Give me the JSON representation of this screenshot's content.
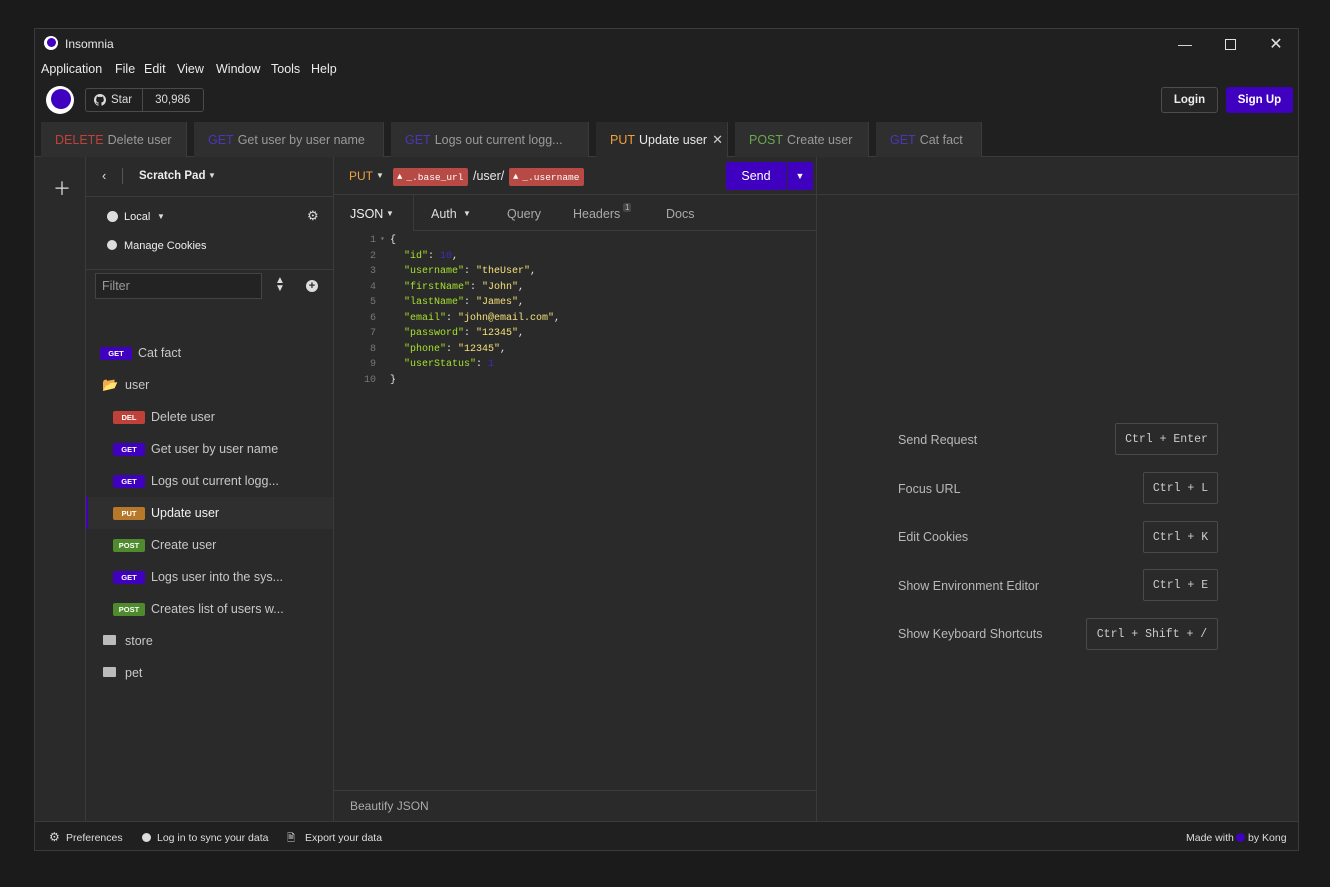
{
  "app": {
    "title": "Insomnia"
  },
  "menu": [
    "Application",
    "File",
    "Edit",
    "View",
    "Window",
    "Tools",
    "Help"
  ],
  "topbar": {
    "star_label": "Star",
    "star_count": "30,986",
    "login": "Login",
    "signup": "Sign Up"
  },
  "tabs": [
    {
      "method": "DELETE",
      "name": "Delete user",
      "color": "#c0413a"
    },
    {
      "method": "GET",
      "name": "Get user by user name",
      "color": "#4a37b8"
    },
    {
      "method": "GET",
      "name": "Logs out current logg...",
      "color": "#4a37b8"
    },
    {
      "method": "PUT",
      "name": "Update user",
      "color": "#f0a040"
    },
    {
      "method": "POST",
      "name": "Create user",
      "color": "#6aa84f"
    },
    {
      "method": "GET",
      "name": "Cat fact",
      "color": "#4a37b8"
    }
  ],
  "sidebar": {
    "workspace": "Scratch Pad",
    "environment": "Local",
    "manage_cookies": "Manage Cookies",
    "filter_placeholder": "Filter",
    "items": [
      {
        "type": "request",
        "method": "GET",
        "name": "Cat fact"
      },
      {
        "type": "folder",
        "name": "user",
        "open": true
      },
      {
        "type": "request",
        "method": "DEL",
        "name": "Delete user"
      },
      {
        "type": "request",
        "method": "GET",
        "name": "Get user by user name"
      },
      {
        "type": "request",
        "method": "GET",
        "name": "Logs out current logg..."
      },
      {
        "type": "request",
        "method": "PUT",
        "name": "Update user",
        "active": true
      },
      {
        "type": "request",
        "method": "POST",
        "name": "Create user"
      },
      {
        "type": "request",
        "method": "GET",
        "name": "Logs user into the sys..."
      },
      {
        "type": "request",
        "method": "POST",
        "name": "Creates list of users w..."
      },
      {
        "type": "folder",
        "name": "store",
        "open": false
      },
      {
        "type": "folder",
        "name": "pet",
        "open": false
      }
    ]
  },
  "request": {
    "method": "PUT",
    "url_tag_1": "_.base_url",
    "url_path": "/user/",
    "url_tag_2": "_.username",
    "send": "Send",
    "tabs": {
      "body": "JSON",
      "auth": "Auth",
      "query": "Query",
      "headers": "Headers",
      "headers_count": "1",
      "docs": "Docs"
    },
    "body_lines": [
      {
        "n": "1",
        "text": "{"
      },
      {
        "n": "2",
        "key": "\"id\"",
        "val": "10",
        "type": "num"
      },
      {
        "n": "3",
        "key": "\"username\"",
        "val": "\"theUser\"",
        "type": "str"
      },
      {
        "n": "4",
        "key": "\"firstName\"",
        "val": "\"John\"",
        "type": "str"
      },
      {
        "n": "5",
        "key": "\"lastName\"",
        "val": "\"James\"",
        "type": "str"
      },
      {
        "n": "6",
        "key": "\"email\"",
        "val": "\"john@email.com\"",
        "type": "str"
      },
      {
        "n": "7",
        "key": "\"password\"",
        "val": "\"12345\"",
        "type": "str"
      },
      {
        "n": "8",
        "key": "\"phone\"",
        "val": "\"12345\"",
        "type": "str"
      },
      {
        "n": "9",
        "key": "\"userStatus\"",
        "val": "1",
        "type": "num",
        "last": true
      },
      {
        "n": "10",
        "text": "}"
      }
    ],
    "beautify": "Beautify JSON"
  },
  "shortcuts": [
    {
      "label": "Send Request",
      "keys": "Ctrl + Enter"
    },
    {
      "label": "Focus URL",
      "keys": "Ctrl + L"
    },
    {
      "label": "Edit Cookies",
      "keys": "Ctrl + K"
    },
    {
      "label": "Show Environment Editor",
      "keys": "Ctrl + E"
    },
    {
      "label": "Show Keyboard Shortcuts",
      "keys": "Ctrl + Shift + /"
    }
  ],
  "statusbar": {
    "preferences": "Preferences",
    "sync": "Log in to sync your data",
    "export": "Export your data",
    "made_with": "Made with",
    "by_kong": "by Kong"
  }
}
